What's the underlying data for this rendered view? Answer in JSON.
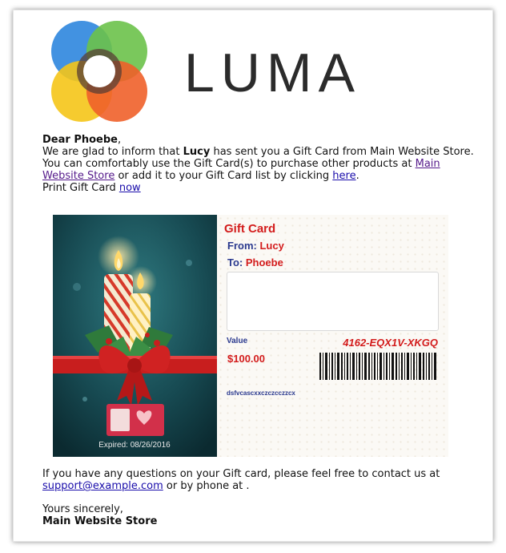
{
  "brand": {
    "name": "LUMA"
  },
  "greeting": {
    "prefix": "Dear ",
    "name": "Phoebe",
    "suffix": ","
  },
  "line1": {
    "before": "We are glad to inform that ",
    "sender": "Lucy",
    "after": " has sent you a Gift Card from Main Website Store."
  },
  "line2": {
    "before": "You can comfortably use the Gift Card(s) to purchase other products at ",
    "store_link": "Main Website Store",
    "middle": " or add it to your Gift Card list by clicking ",
    "here_link": "here",
    "after": "."
  },
  "line3": {
    "before": "Print Gift Card ",
    "now_link": "now"
  },
  "card": {
    "title": "Gift Card",
    "from_label": "From:",
    "from_value": "Lucy",
    "to_label": "To:",
    "to_value": "Phoebe",
    "value_label": "Value",
    "value": "$100.00",
    "code": "4162-EQX1V-XKGQ",
    "note": "dsfvcascxxczczcczzcx",
    "expired": "Expired: 08/26/2016"
  },
  "footer": {
    "question": "If you have any questions on your Gift card, please feel free to contact us at ",
    "email": "support@example.com",
    "after_email": " or by phone at .",
    "closing": "Yours sincerely,",
    "signature": "Main Website Store"
  },
  "colors": {
    "accent_red": "#d31c1c",
    "label_blue": "#2b3a8f",
    "link": "#1a0dab",
    "visited_link": "#551a8b"
  }
}
